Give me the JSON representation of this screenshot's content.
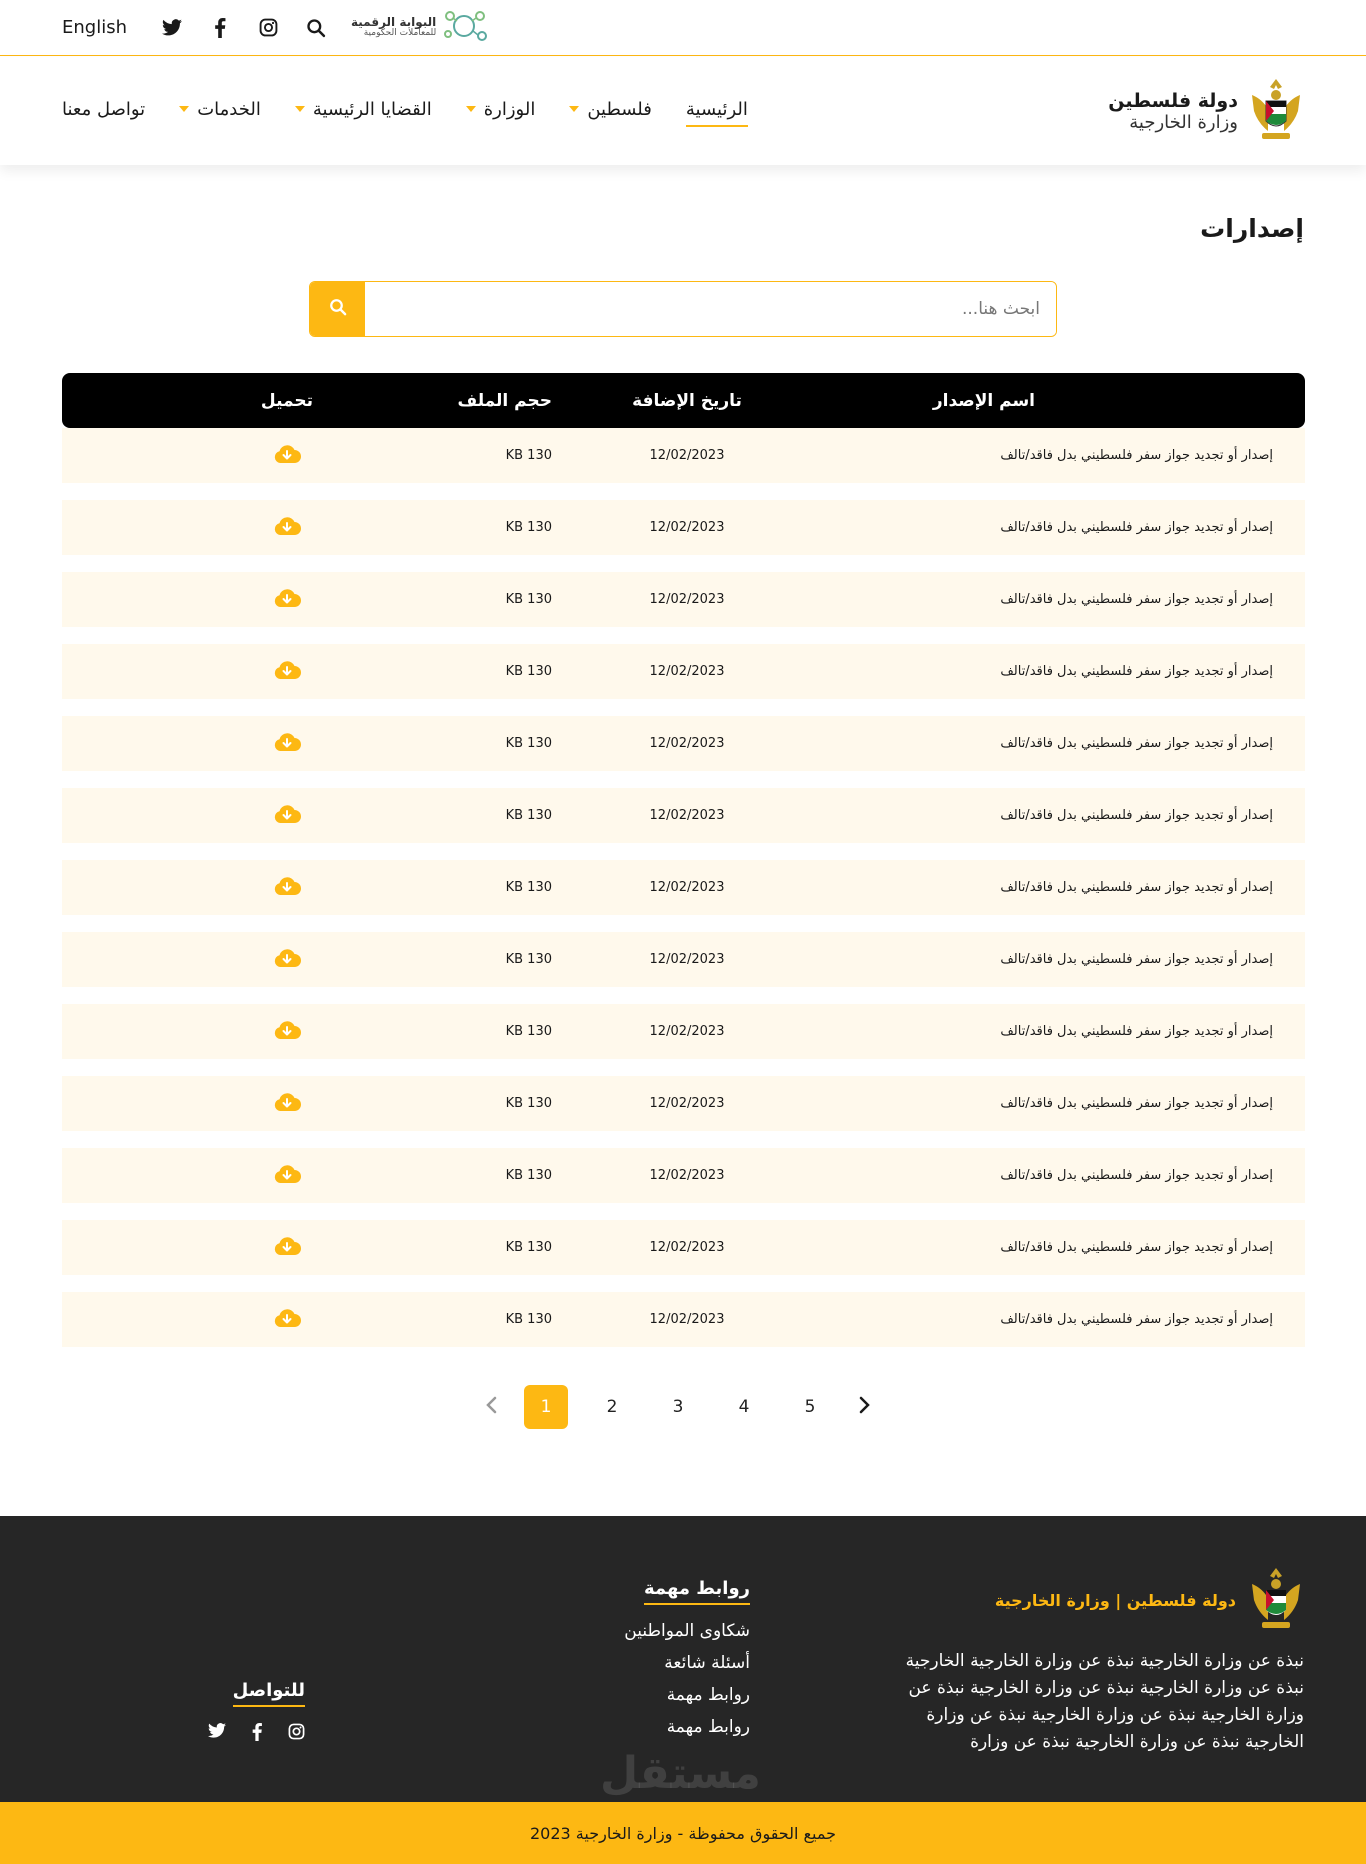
{
  "topbar": {
    "lang_label": "English",
    "portal_line1": "البوابة الرقمية",
    "portal_line2": "للمعاملات الحكومية"
  },
  "nav": {
    "brand_line1": "دولة فلسطين",
    "brand_line2": "وزارة الخارجية",
    "items": [
      {
        "label": "الرئيسية"
      },
      {
        "label": "فلسطين"
      },
      {
        "label": "الوزارة"
      },
      {
        "label": "القضايا الرئيسية"
      },
      {
        "label": "الخدمات"
      },
      {
        "label": "تواصل معنا"
      }
    ]
  },
  "page": {
    "title": "إصدارات",
    "search_placeholder": "ابحث هنا..."
  },
  "table": {
    "headers": {
      "name": "اسم الإصدار",
      "date": "تاريخ الإضافة",
      "size": "حجم الملف",
      "download": "تحميل"
    },
    "rows": [
      {
        "name": "إصدار أو تجديد جواز سفر فلسطيني بدل فاقد/تالف",
        "date": "12/02/2023",
        "size": "KB 130"
      },
      {
        "name": "إصدار أو تجديد جواز سفر فلسطيني بدل فاقد/تالف",
        "date": "12/02/2023",
        "size": "KB 130"
      },
      {
        "name": "إصدار أو تجديد جواز سفر فلسطيني بدل فاقد/تالف",
        "date": "12/02/2023",
        "size": "KB 130"
      },
      {
        "name": "إصدار أو تجديد جواز سفر فلسطيني بدل فاقد/تالف",
        "date": "12/02/2023",
        "size": "KB 130"
      },
      {
        "name": "إصدار أو تجديد جواز سفر فلسطيني بدل فاقد/تالف",
        "date": "12/02/2023",
        "size": "KB 130"
      },
      {
        "name": "إصدار أو تجديد جواز سفر فلسطيني بدل فاقد/تالف",
        "date": "12/02/2023",
        "size": "KB 130"
      },
      {
        "name": "إصدار أو تجديد جواز سفر فلسطيني بدل فاقد/تالف",
        "date": "12/02/2023",
        "size": "KB 130"
      },
      {
        "name": "إصدار أو تجديد جواز سفر فلسطيني بدل فاقد/تالف",
        "date": "12/02/2023",
        "size": "KB 130"
      },
      {
        "name": "إصدار أو تجديد جواز سفر فلسطيني بدل فاقد/تالف",
        "date": "12/02/2023",
        "size": "KB 130"
      },
      {
        "name": "إصدار أو تجديد جواز سفر فلسطيني بدل فاقد/تالف",
        "date": "12/02/2023",
        "size": "KB 130"
      },
      {
        "name": "إصدار أو تجديد جواز سفر فلسطيني بدل فاقد/تالف",
        "date": "12/02/2023",
        "size": "KB 130"
      },
      {
        "name": "إصدار أو تجديد جواز سفر فلسطيني بدل فاقد/تالف",
        "date": "12/02/2023",
        "size": "KB 130"
      },
      {
        "name": "إصدار أو تجديد جواز سفر فلسطيني بدل فاقد/تالف",
        "date": "12/02/2023",
        "size": "KB 130"
      }
    ]
  },
  "pagination": {
    "pages": [
      "1",
      "2",
      "3",
      "4",
      "5"
    ],
    "current": "1"
  },
  "footer": {
    "brand": "دولة فلسطين | وزارة الخارجية",
    "about": "نبذة عن وزارة الخارجية نبذة عن وزارة الخارجية الخارجية نبذة عن وزارة الخارجية نبذة عن وزارة الخارجية نبذة عن وزارة الخارجية نبذة عن وزارة الخارجية نبذة عن وزارة الخارجية نبذة عن وزارة الخارجية نبذة عن وزارة",
    "links_title": "روابط مهمة",
    "links": [
      "شكاوى المواطنين",
      "أسئلة شائعة",
      "روابط مهمة",
      "روابط مهمة"
    ],
    "contact_title": "للتواصل",
    "copyright": "جميع الحقوق محفوظة - وزارة الخارجية 2023",
    "watermark": "مستقل"
  },
  "colors": {
    "accent": "#FDB813",
    "dark": "#262626",
    "row_bg": "#FFF9EC"
  },
  "icons": [
    "twitter-icon",
    "facebook-icon",
    "instagram-icon",
    "search-icon",
    "cloud-download-icon",
    "chevron-left-icon",
    "chevron-right-icon",
    "emblem-icon"
  ]
}
